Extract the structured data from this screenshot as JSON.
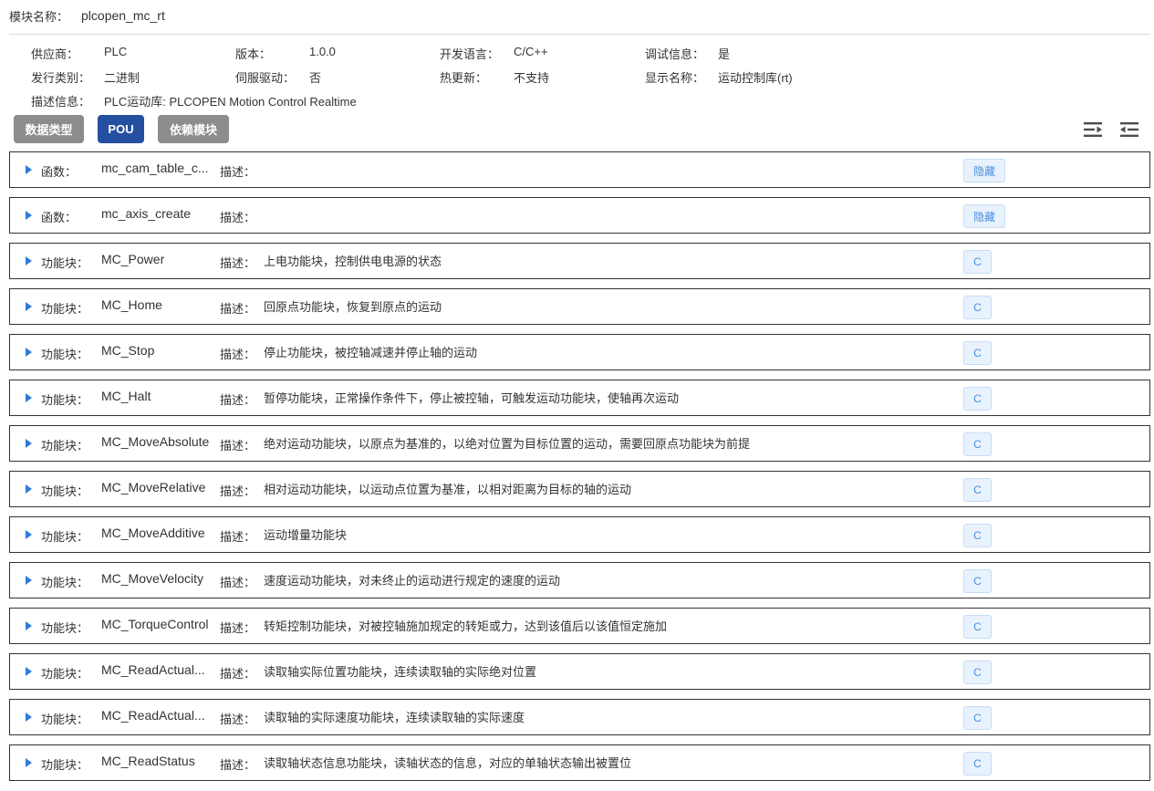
{
  "module": {
    "label": "模块名称：",
    "value": "plcopen_mc_rt"
  },
  "info": [
    [
      {
        "label": "供应商：",
        "value": "PLC"
      },
      {
        "label": "版本：",
        "value": "1.0.0"
      },
      {
        "label": "开发语言：",
        "value": "C/C++"
      },
      {
        "label": "调试信息：",
        "value": "是"
      }
    ],
    [
      {
        "label": "发行类别：",
        "value": "二进制"
      },
      {
        "label": "伺服驱动：",
        "value": "否"
      },
      {
        "label": "热更新：",
        "value": "不支持"
      },
      {
        "label": "显示名称：",
        "value": "运动控制库(rt)"
      }
    ],
    [
      {
        "label": "描述信息：",
        "value": "PLC运动库: PLCOPEN Motion Control Realtime"
      }
    ]
  ],
  "toolbar": {
    "data_types": "数据类型",
    "pou": "POU",
    "dependencies": "依赖模块"
  },
  "icons": {
    "expand_all": "indent-icon",
    "collapse_all": "outdent-icon"
  },
  "desc_label": "描述：",
  "rows": [
    {
      "kind": "函数：",
      "name": "mc_cam_table_c...",
      "desc": "",
      "action": "隐藏"
    },
    {
      "kind": "函数：",
      "name": "mc_axis_create",
      "desc": "",
      "action": "隐藏"
    },
    {
      "kind": "功能块：",
      "name": "MC_Power",
      "desc": "上电功能块，控制供电电源的状态",
      "action": "C"
    },
    {
      "kind": "功能块：",
      "name": "MC_Home",
      "desc": "回原点功能块，恢复到原点的运动",
      "action": "C"
    },
    {
      "kind": "功能块：",
      "name": "MC_Stop",
      "desc": "停止功能块，被控轴减速并停止轴的运动",
      "action": "C"
    },
    {
      "kind": "功能块：",
      "name": "MC_Halt",
      "desc": "暂停功能块，正常操作条件下，停止被控轴，可触发运动功能块，使轴再次运动",
      "action": "C"
    },
    {
      "kind": "功能块：",
      "name": "MC_MoveAbsolute",
      "desc": "绝对运动功能块，以原点为基准的，以绝对位置为目标位置的运动，需要回原点功能块为前提",
      "action": "C"
    },
    {
      "kind": "功能块：",
      "name": "MC_MoveRelative",
      "desc": "相对运动功能块，以运动点位置为基准，以相对距离为目标的轴的运动",
      "action": "C"
    },
    {
      "kind": "功能块：",
      "name": "MC_MoveAdditive",
      "desc": "运动增量功能块",
      "action": "C"
    },
    {
      "kind": "功能块：",
      "name": "MC_MoveVelocity",
      "desc": "速度运动功能块，对未终止的运动进行规定的速度的运动",
      "action": "C"
    },
    {
      "kind": "功能块：",
      "name": "MC_TorqueControl",
      "desc": "转矩控制功能块，对被控轴施加规定的转矩或力，达到该值后以该值恒定施加",
      "action": "C"
    },
    {
      "kind": "功能块：",
      "name": "MC_ReadActual...",
      "desc": "读取轴实际位置功能块，连续读取轴的实际绝对位置",
      "action": "C"
    },
    {
      "kind": "功能块：",
      "name": "MC_ReadActual...",
      "desc": "读取轴的实际速度功能块，连续读取轴的实际速度",
      "action": "C"
    },
    {
      "kind": "功能块：",
      "name": "MC_ReadStatus",
      "desc": "读取轴状态信息功能块，读轴状态的信息，对应的单轴状态输出被置位",
      "action": "C"
    }
  ]
}
